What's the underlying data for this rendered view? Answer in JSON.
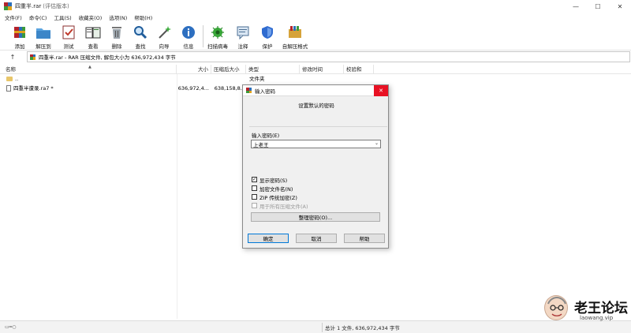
{
  "window": {
    "title": "四重半.rar",
    "title_tag": "(评估版本)"
  },
  "window_controls": {
    "minimize": "—",
    "maximize": "☐",
    "close": "✕"
  },
  "menu": [
    "文件(F)",
    "命令(C)",
    "工具(S)",
    "收藏夹(O)",
    "选项(N)",
    "帮助(H)"
  ],
  "toolbar": [
    {
      "label": "添加",
      "icon": "add-archive-icon"
    },
    {
      "label": "解压到",
      "icon": "extract-to-icon"
    },
    {
      "label": "测试",
      "icon": "test-icon"
    },
    {
      "label": "查看",
      "icon": "view-icon"
    },
    {
      "label": "删除",
      "icon": "delete-icon"
    },
    {
      "label": "查找",
      "icon": "find-icon"
    },
    {
      "label": "向导",
      "icon": "wizard-icon"
    },
    {
      "label": "信息",
      "icon": "info-icon"
    },
    {
      "label": "扫描病毒",
      "icon": "virus-scan-icon"
    },
    {
      "label": "注释",
      "icon": "comment-icon"
    },
    {
      "label": "保护",
      "icon": "protect-icon"
    },
    {
      "label": "自解压格式",
      "icon": "sfx-icon"
    }
  ],
  "address": {
    "up": "↑",
    "text": "四重半.rar - RAR 压缩文件, 解包大小为 636,972,434 字节"
  },
  "columns": [
    "名称",
    "大小",
    "压缩后大小",
    "类型",
    "修改时间",
    "校验和"
  ],
  "files": [
    {
      "name": "..",
      "size": "",
      "packed": "",
      "type": "文件夹",
      "kind": "folder"
    },
    {
      "name": "四重半遭录.ra7 *",
      "size": "636,972,4...",
      "packed": "638,158,8...",
      "type": "",
      "kind": "file"
    }
  ],
  "dialog": {
    "title": "输入密码",
    "close": "✕",
    "heading": "设置默认的密码",
    "pwd_label": "输入密码(E)",
    "pwd_value": "上老王",
    "dropdown_arrow": "⌄",
    "checkboxes": [
      {
        "label": "显示密码(S)",
        "checked": true,
        "enabled": true
      },
      {
        "label": "加密文件名(N)",
        "checked": false,
        "enabled": true
      },
      {
        "label": "ZIP 传统加密(Z)",
        "checked": false,
        "enabled": true
      },
      {
        "label": "用于所有压缩文件(A)",
        "checked": false,
        "enabled": false
      }
    ],
    "check_mark": "✓",
    "organize": "整理密码(O)...",
    "ok": "确定",
    "cancel": "取消",
    "help": "帮助"
  },
  "status": {
    "drive": "▭═○",
    "text": "总计 1 文件, 636,972,434 字节"
  },
  "watermark": {
    "text": "老王论坛",
    "sub": "laowang.vip"
  }
}
